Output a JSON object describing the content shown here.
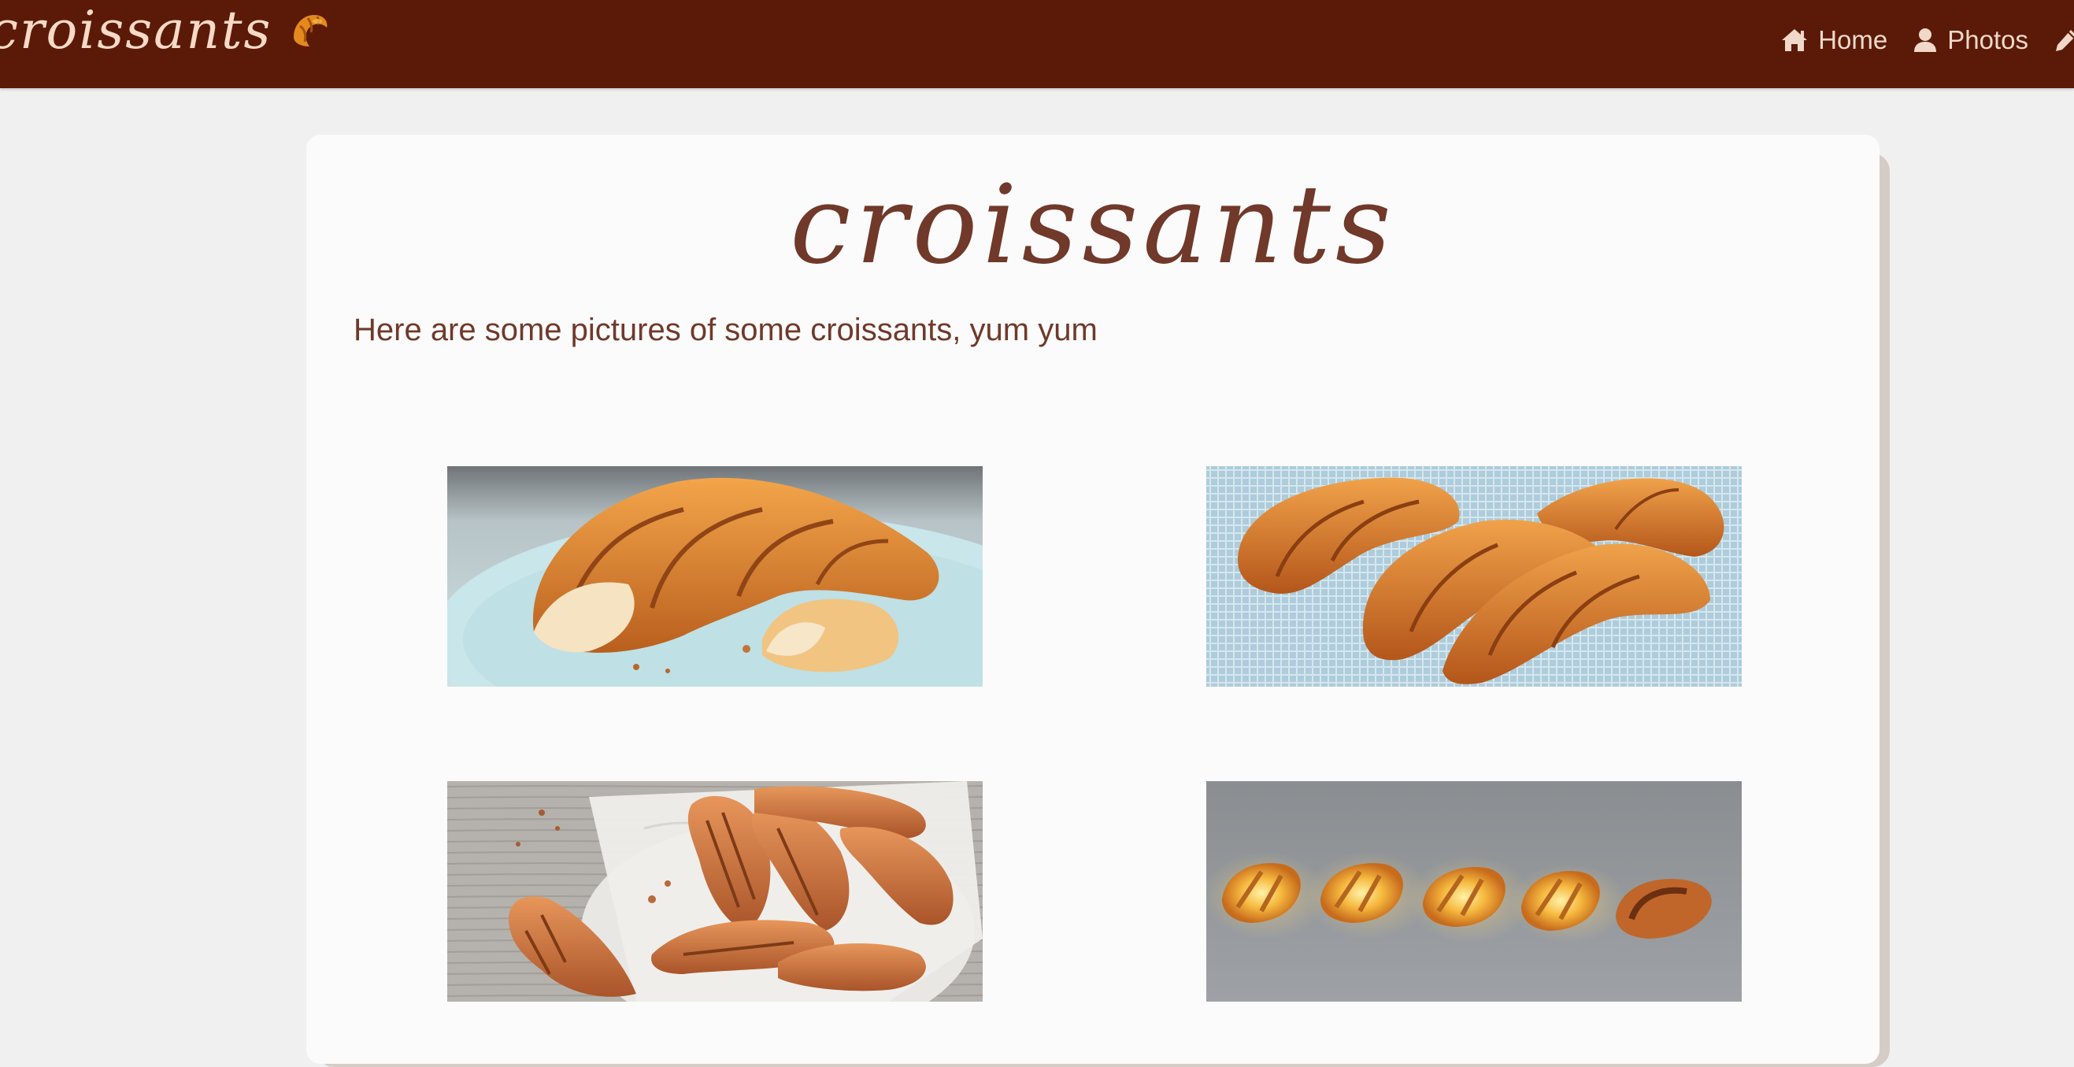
{
  "navbar": {
    "brand_text": "croissants",
    "brand_icon": "croissant-icon",
    "links": [
      {
        "label": "Home",
        "icon": "home-icon"
      },
      {
        "label": "Photos",
        "icon": "user-icon"
      },
      {
        "label": "",
        "icon": "pencil-icon"
      }
    ],
    "background_color": "#5b1a08",
    "text_color": "#f1d8c9"
  },
  "card": {
    "title": "croissants",
    "intro": "Here are some pictures of some croissants, yum yum",
    "text_color": "#70392a"
  },
  "gallery": {
    "photos": [
      {
        "subject": "croissant on light blue plate"
      },
      {
        "subject": "croissants on blue cloth"
      },
      {
        "subject": "croissants on parchment paper"
      },
      {
        "subject": "glowing croissant lamps"
      }
    ]
  }
}
